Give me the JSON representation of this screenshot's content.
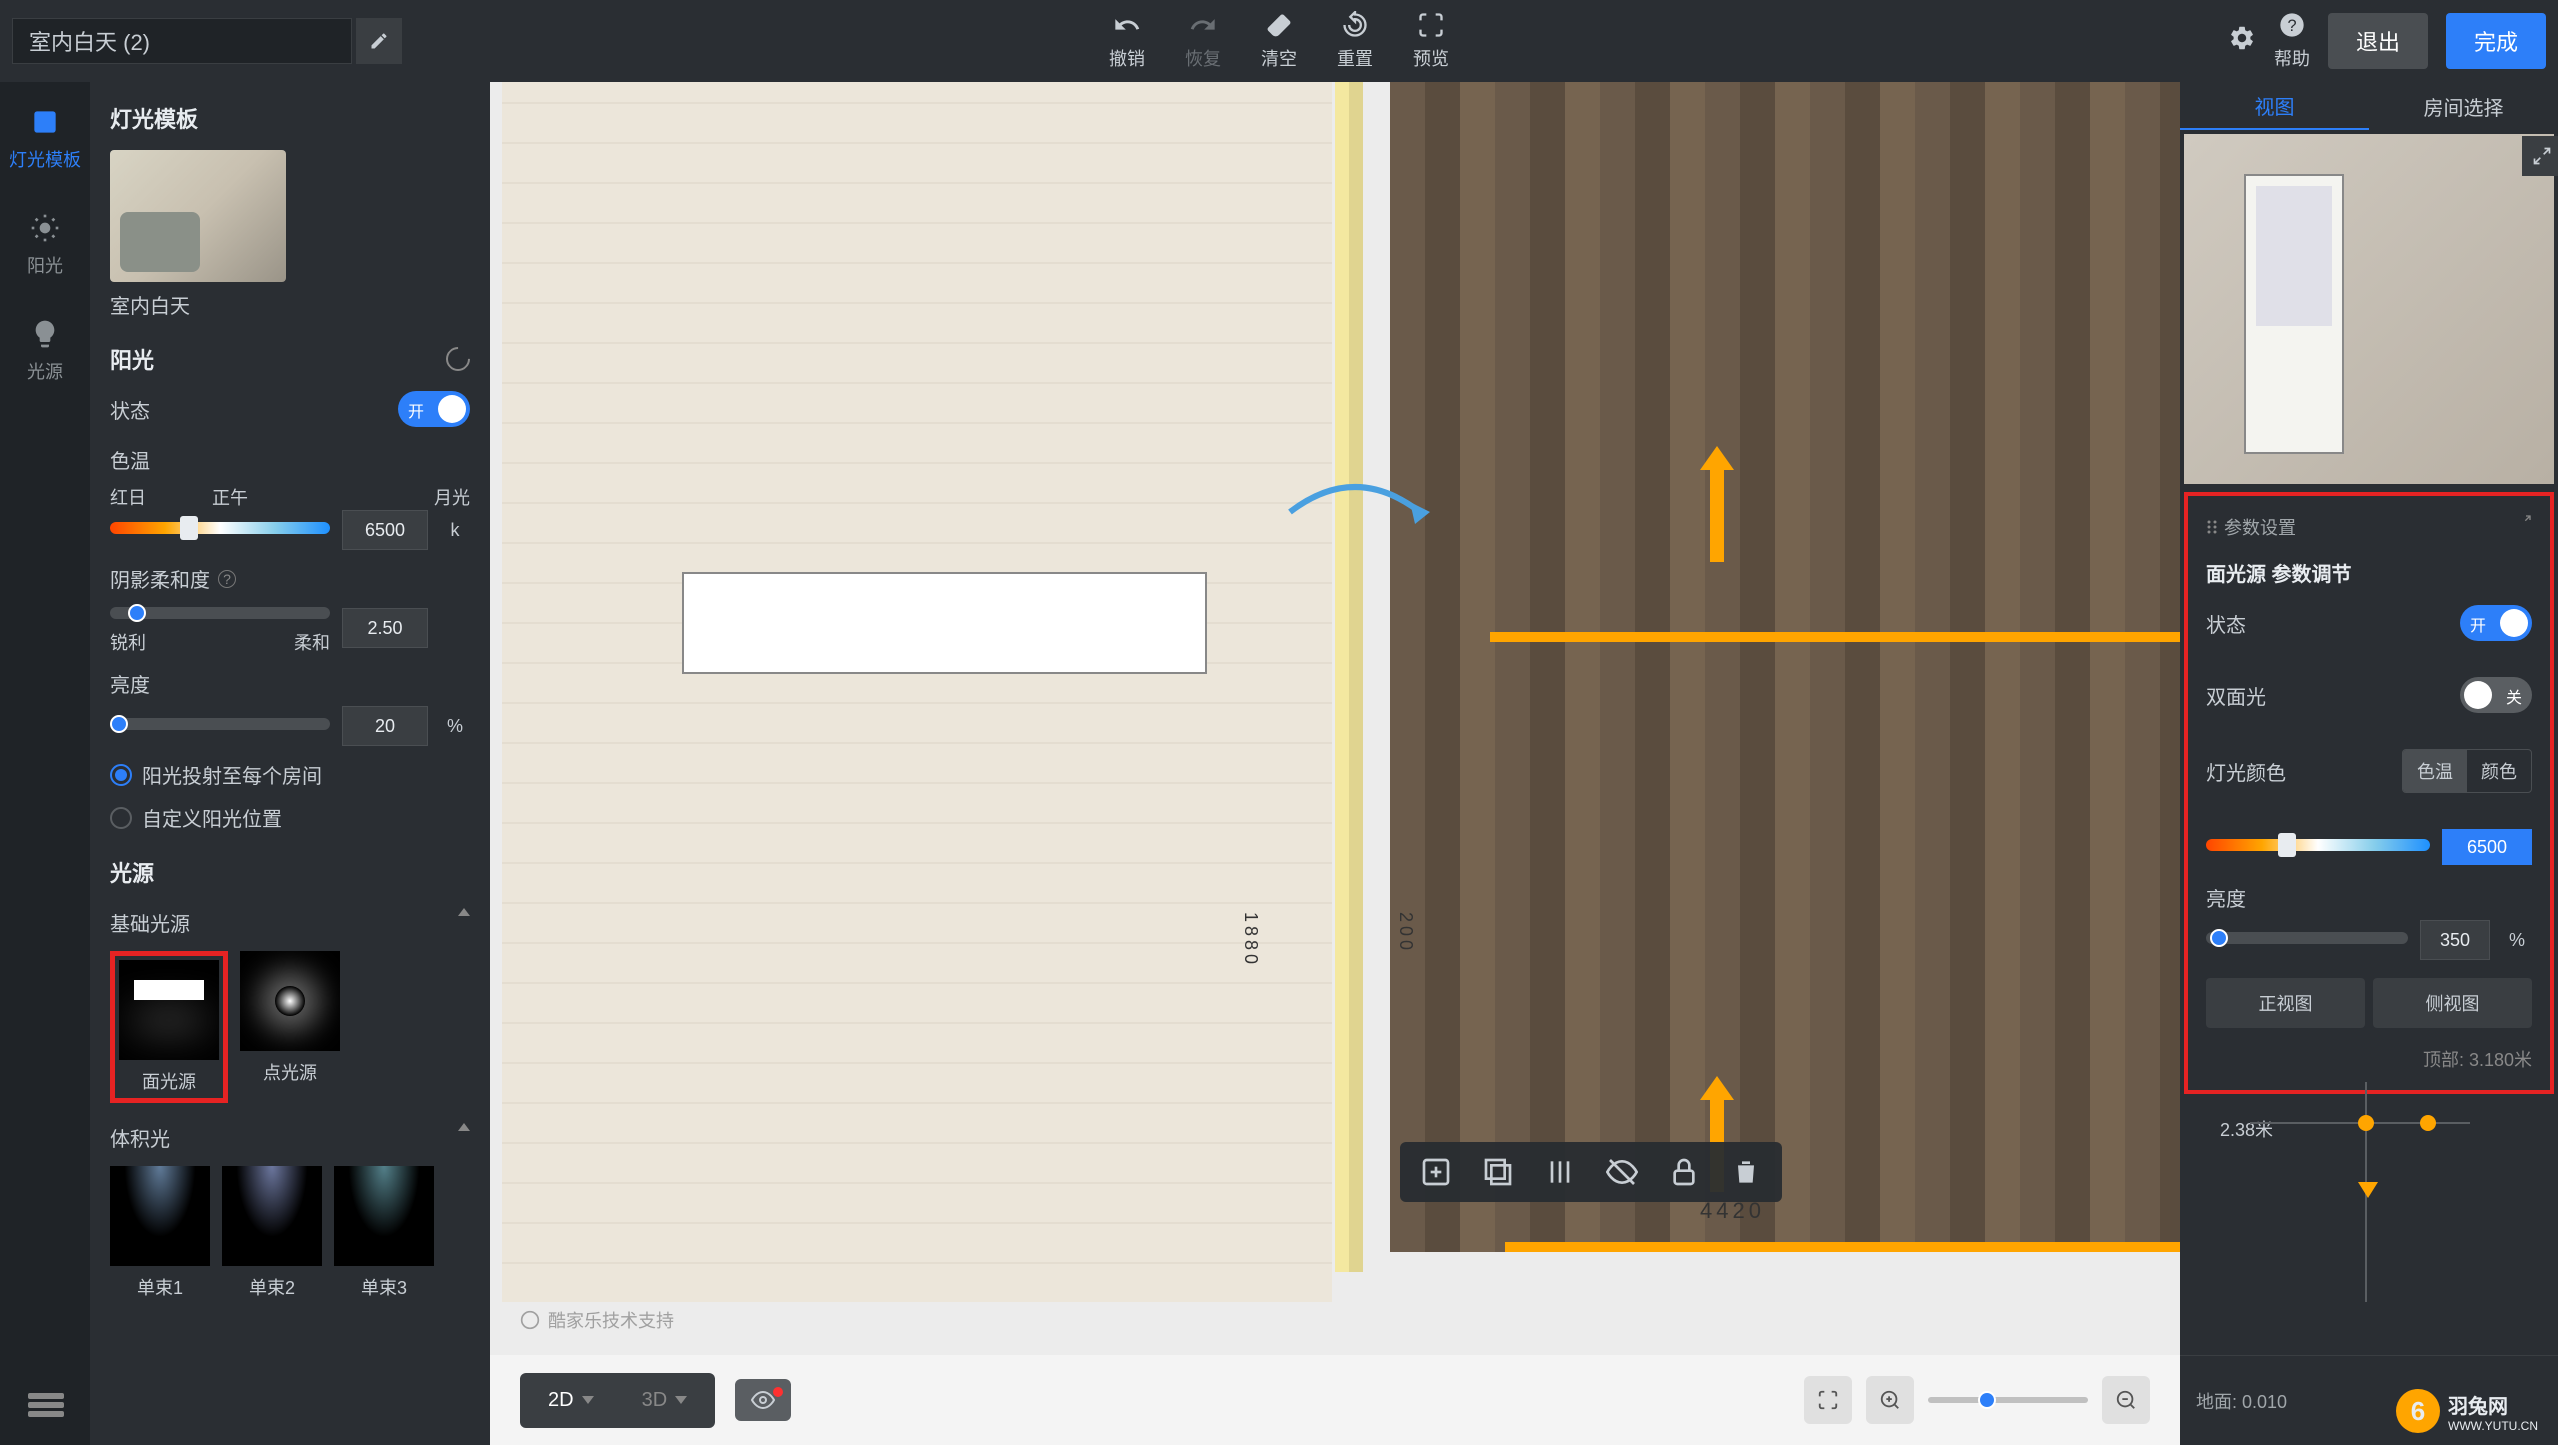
{
  "project": {
    "name": "室内白天 (2)"
  },
  "toolbar": {
    "undo": "撤销",
    "redo": "恢复",
    "clear": "清空",
    "reset": "重置",
    "preview": "预览",
    "settings": "设置",
    "help": "帮助",
    "exit": "退出",
    "done": "完成"
  },
  "nav": {
    "light_template": "灯光模板",
    "sunlight": "阳光",
    "light_source": "光源"
  },
  "panel": {
    "template_section": "灯光模板",
    "template_name": "室内白天",
    "sunlight_section": "阳光",
    "status_label": "状态",
    "status_on": "开",
    "color_temp_label": "色温",
    "ct_labels": {
      "red_sun": "红日",
      "noon": "正午",
      "moonlight": "月光"
    },
    "ct_value": "6500",
    "ct_unit": "k",
    "shadow_softness_label": "阴影柔和度",
    "shadow_labels": {
      "sharp": "锐利",
      "soft": "柔和"
    },
    "shadow_value": "2.50",
    "brightness_label": "亮度",
    "brightness_value": "20",
    "brightness_unit": "%",
    "radio_project_all": "阳光投射至每个房间",
    "radio_custom_pos": "自定义阳光位置",
    "source_section": "光源",
    "basic_source_title": "基础光源",
    "area_light": "面光源",
    "point_light": "点光源",
    "volume_light_title": "体积光",
    "beam1": "单束1",
    "beam2": "单束2",
    "beam3": "单束3"
  },
  "canvas": {
    "dim_1880": "1880",
    "dim_200": "200",
    "dim_4420": "4420",
    "dim_mode_2d": "2D",
    "dim_mode_3d": "3D",
    "tech_support": "酷家乐技术支持"
  },
  "right": {
    "tab_view": "视图",
    "tab_room": "房间选择",
    "param_settings": "参数设置",
    "param_title": "面光源 参数调节",
    "status_label": "状态",
    "status_on": "开",
    "double_side_label": "双面光",
    "double_side_off": "关",
    "light_color_label": "灯光颜色",
    "segment_ct": "色温",
    "segment_color": "颜色",
    "ct_value": "6500",
    "brightness_label": "亮度",
    "brightness_value": "350",
    "brightness_unit": "%",
    "btn_ortho": "正视图",
    "btn_side": "侧视图",
    "top_info": "顶部: 3.180米",
    "height_label": "2.38米",
    "floor_info": "地面: 0.010",
    "watermark_name": "羽兔网",
    "watermark_url": "WWW.YUTU.CN"
  }
}
